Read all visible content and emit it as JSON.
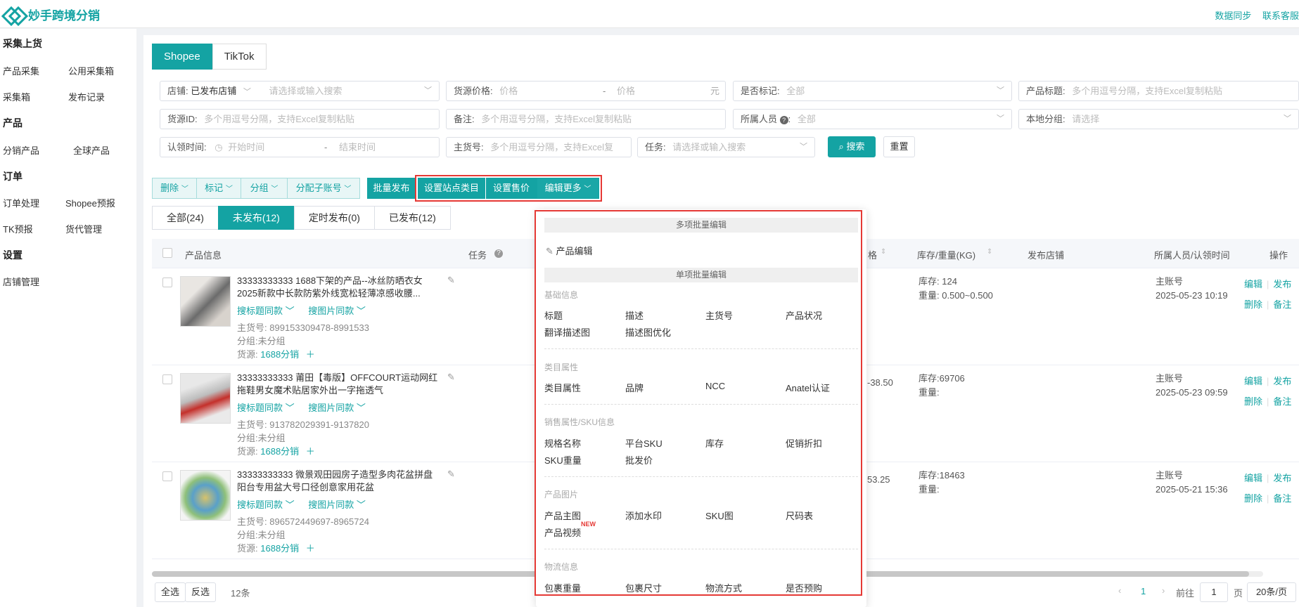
{
  "app": {
    "name": "妙手跨境分销",
    "top_links": [
      "数据同步",
      "联系客服"
    ]
  },
  "sidebar": {
    "groups": [
      {
        "title": "采集上货",
        "items": [
          "产品采集",
          "公用采集箱",
          "采集箱",
          "发布记录"
        ]
      },
      {
        "title": "产品",
        "items": [
          "分销产品",
          "全球产品"
        ]
      },
      {
        "title": "订单",
        "items": [
          "订单处理",
          "Shopee预报",
          "TK预报",
          "货代管理"
        ]
      },
      {
        "title": "设置",
        "items": [
          "店铺管理"
        ]
      }
    ],
    "active_item": "采集箱"
  },
  "platform_tabs": [
    "Shopee",
    "TikTok"
  ],
  "filters": {
    "store": {
      "label": "店铺:",
      "value": "已发布店铺",
      "placeholder": "请选择或输入搜索"
    },
    "price": {
      "label": "货源价格:",
      "min_placeholder": "价格",
      "sep": "-",
      "max_placeholder": "价格",
      "unit": "元"
    },
    "marked": {
      "label": "是否标记:",
      "value": "全部"
    },
    "title": {
      "label": "产品标题:",
      "placeholder": "多个用逗号分隔，支持Excel复制粘贴"
    },
    "source_id": {
      "label": "货源ID:",
      "placeholder": "多个用逗号分隔，支持Excel复制粘贴"
    },
    "remark": {
      "label": "备注:",
      "placeholder": "多个用逗号分隔，支持Excel复制粘贴"
    },
    "owner": {
      "label": "所属人员",
      "value": "全部"
    },
    "local_group": {
      "label": "本地分组:",
      "placeholder": "请选择"
    },
    "claim_time": {
      "label": "认领时间:",
      "start": "开始时间",
      "sep": "-",
      "end": "结束时间"
    },
    "main_sku": {
      "label": "主货号:",
      "placeholder": "多个用逗号分隔，支持Excel复"
    },
    "task": {
      "label": "任务:",
      "placeholder": "请选择或输入搜索"
    },
    "search_label": "搜索",
    "reset_label": "重置"
  },
  "toolbar": {
    "delete": "删除",
    "mark": "标记",
    "group": "分组",
    "assign": "分配子账号",
    "batch_publish": "批量发布",
    "set_category": "设置站点类目",
    "set_price": "设置售价",
    "edit_more": "编辑更多"
  },
  "status_tabs": [
    "全部(24)",
    "未发布(12)",
    "定时发布(0)",
    "已发布(12)"
  ],
  "table": {
    "headers": {
      "product": "产品信息",
      "task": "任务",
      "price": "格",
      "stock": "库存/重量(KG)",
      "store": "发布店铺",
      "owner": "所属人员/认领时间",
      "ops": "操作"
    },
    "link_title_same": "搜标题同款",
    "link_image_same": "搜图片同款",
    "main_sku_label": "主货号:",
    "group_label": "分组:",
    "source_label": "货源:",
    "stock_label": "库存:",
    "weight_label": "重量:",
    "ops": {
      "edit": "编辑",
      "publish": "发布",
      "delete": "删除",
      "remark": "备注"
    },
    "rows": [
      {
        "title": "33333333333 1688下架的产品--冰丝防晒衣女2025新款中长款防紫外线宽松轻薄凉感收腰...",
        "main_sku": "899153309478-8991533",
        "group": "未分组",
        "source": "1688分销",
        "price": "",
        "stock": "124",
        "weight": "0.500~0.500",
        "owner": "主账号",
        "claim_time": "2025-05-23 10:19"
      },
      {
        "title": "33333333333 莆田【毒版】OFFCOURT运动网红拖鞋男女魔术贴居家外出一字拖透气",
        "main_sku": "913782029391-9137820",
        "group": "未分组",
        "source": "1688分销",
        "price": "-38.50",
        "stock": "69706",
        "weight": "",
        "owner": "主账号",
        "claim_time": "2025-05-23 09:59"
      },
      {
        "title": "33333333333 微景观田园房子造型多肉花盆拼盘阳台专用盆大号口径创意家用花盆",
        "main_sku": "896572449697-8965724",
        "group": "未分组",
        "source": "1688分销",
        "price": "53.25",
        "stock": "18463",
        "weight": "",
        "owner": "主账号",
        "claim_time": "2025-05-21 15:36"
      }
    ]
  },
  "bottom": {
    "select_all": "全选",
    "invert": "反选",
    "count": "12条",
    "page": "1",
    "goto_label": "前往",
    "goto_value": "1",
    "page_suffix": "页",
    "page_size": "20条/页"
  },
  "dropdown": {
    "multi_header": "多项批量编辑",
    "product_edit": "产品编辑",
    "single_header": "单项批量编辑",
    "sections": [
      {
        "title": "基础信息",
        "items": [
          "标题",
          "描述",
          "主货号",
          "产品状况",
          "翻译描述图",
          "描述图优化"
        ]
      },
      {
        "title": "类目属性",
        "items": [
          "类目属性",
          "品牌",
          "NCC",
          "Anatel认证"
        ]
      },
      {
        "title": "销售属性/SKU信息",
        "items": [
          "规格名称",
          "平台SKU",
          "库存",
          "促销折扣",
          "SKU重量",
          "批发价"
        ]
      },
      {
        "title": "产品图片",
        "items": [
          "产品主图",
          "添加水印",
          "SKU图",
          "尺码表",
          "产品视频"
        ]
      },
      {
        "title": "物流信息",
        "items": [
          "包裹重量",
          "包裹尺寸",
          "物流方式",
          "是否预购"
        ]
      }
    ],
    "new_badge": "NEW"
  },
  "colors": {
    "accent": "#14a3a3",
    "highlight": "#e53935"
  }
}
